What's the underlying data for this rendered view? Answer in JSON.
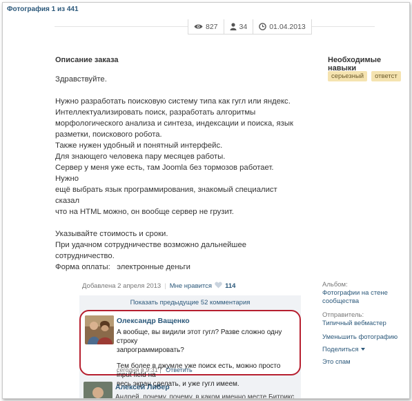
{
  "header": {
    "photo_counter": "Фотография 1 из 441"
  },
  "stats": {
    "views": "827",
    "users": "34",
    "date": "01.04.2013"
  },
  "order": {
    "title": "Описание заказа",
    "paragraphs": [
      [
        "Здравствуйте."
      ],
      [
        "Нужно разработать поисковую систему типа как гугл или яндекс.",
        "Интеллектуализировать поиск, разработать алгоритмы",
        "морфологического анализа и синтеза, индексации и поиска, язык",
        "разметки, поискового робота.",
        "Также нужен удобный и понятный интерфейс.",
        "Для знающего человека пару месяцев работы.",
        "Сервер у меня уже есть, там Joomla без тормозов работает. Нужно",
        "ещё выбрать язык программирования, знакомый специалист сказал",
        "что на HTML можно, он вообще сервер не грузит."
      ],
      [
        "Указывайте стоимость и сроки.",
        "При удачном сотрудничестве возможно дальнейшее сотрудничество."
      ]
    ],
    "payment_label": "Форма оплаты:",
    "payment_value": "электронные деньги"
  },
  "skills": {
    "title": "Необходимые навыки",
    "tags": [
      "серьезный",
      "ответст"
    ]
  },
  "post": {
    "added": "Добавлена 2 апреля 2013",
    "like_label": "Мне нравится",
    "likes": "114"
  },
  "comments": {
    "show_previous": "Показать предыдущие 52 комментария",
    "items": [
      {
        "author": "Олександр Ващенко",
        "text_lines": [
          "А вообще, вы видили этот гугл? Разве сложно одну строку",
          "запрограммировать?"
        ],
        "text_lines_2": [
          "Тем более в джумле уже поиск есть, можно просто input field на",
          "весь экран сделать, и уже гугл имеем."
        ],
        "time": "сегодня в 9:31",
        "reply": "Ответить"
      },
      {
        "author": "Алексей Либер",
        "text": "Андрей, почему, почему, в каком именно месте Битрикс"
      }
    ]
  },
  "sidebar": {
    "album_label": "Альбом:",
    "album_value": "Фотографии на стене сообщества",
    "sender_label": "Отправитель:",
    "sender_value": "Типичный вебмастер",
    "actions": [
      "Уменьшить фотографию",
      "Поделиться",
      "Это спам"
    ]
  },
  "colors": {
    "link": "#2b587a",
    "highlight_border": "#b61e2e",
    "skill_tag_bg": "#f5e3b0"
  }
}
